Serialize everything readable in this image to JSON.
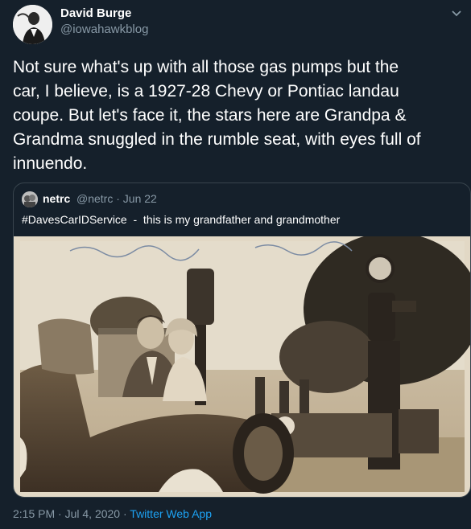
{
  "author": {
    "name": "David Burge",
    "handle": "@iowahawkblog"
  },
  "tweet": {
    "text_lines": [
      "Not sure what's up with all those gas pumps but the",
      "car, I believe, is a 1927-28 Chevy or Pontiac landau",
      "coupe. But let's face it, the stars here are Grandpa &",
      "Grandma snuggled in the rumble seat, with eyes full of",
      "innuendo."
    ]
  },
  "quoted": {
    "name": "netrc",
    "handle": "@netrc",
    "separator": "·",
    "date": "Jun 22",
    "text": "#DavesCarIDService  -  this is my grandfather and grandmother"
  },
  "meta": {
    "time": "2:15 PM",
    "separator": " · ",
    "date": "Jul 4, 2020",
    "app": "Twitter Web App"
  },
  "colors": {
    "background": "#15202b",
    "secondary_text": "#8899a6",
    "link": "#1da1f2",
    "border": "#38444d"
  },
  "icons": {
    "menu": "chevron-down-icon"
  }
}
